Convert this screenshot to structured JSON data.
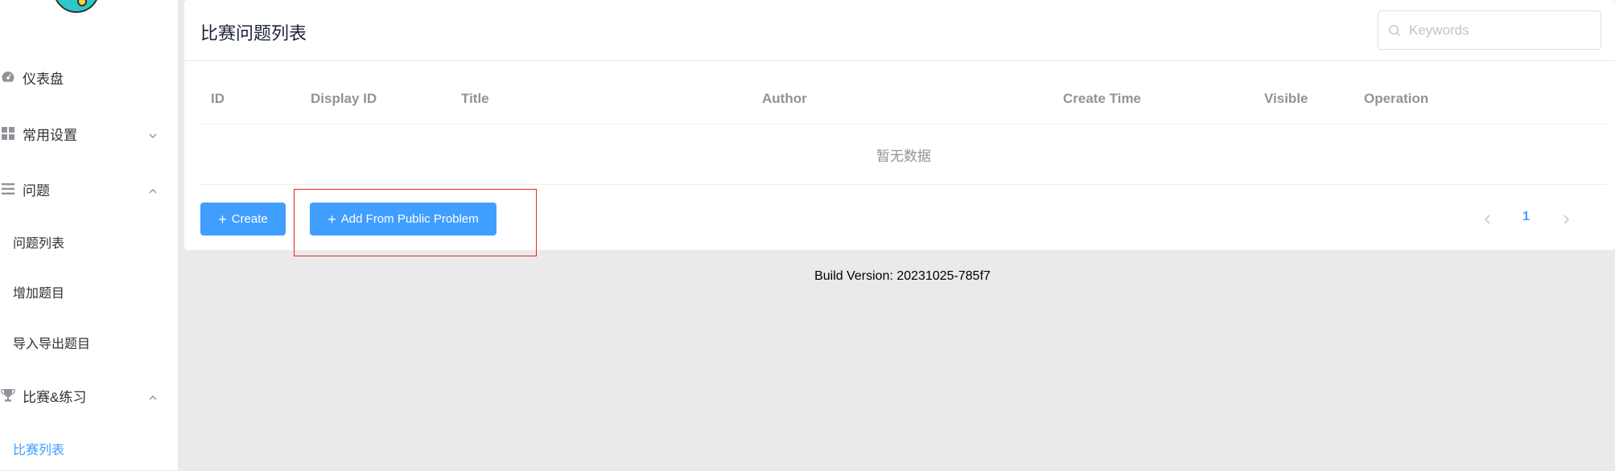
{
  "sidebar": {
    "menu": [
      {
        "label": "仪表盘",
        "icon": "dashboard-icon"
      },
      {
        "label": "常用设置",
        "icon": "grid-icon",
        "arrow": "chevron-down-icon"
      },
      {
        "label": "问题",
        "icon": "list-icon",
        "arrow": "chevron-up-icon"
      },
      {
        "label": "比赛&练习",
        "icon": "trophy-icon",
        "arrow": "chevron-up-icon"
      }
    ],
    "problem_sub": [
      "问题列表",
      "增加题目",
      "导入导出题目"
    ],
    "contest_sub": [
      "比赛列表"
    ]
  },
  "main": {
    "title": "比赛问题列表",
    "search": {
      "placeholder": "Keywords",
      "value": ""
    },
    "table": {
      "columns": [
        "ID",
        "Display ID",
        "Title",
        "Author",
        "Create Time",
        "Visible",
        "Operation"
      ],
      "empty_text": "暂无数据"
    },
    "buttons": {
      "create": "Create",
      "add_public": "Add From Public Problem"
    },
    "pagination": {
      "current": "1"
    }
  },
  "footer": {
    "build": "Build Version: 20231025-785f7"
  },
  "colors": {
    "accent": "#409eff",
    "highlight": "#e0281e",
    "background": "#eaeaea"
  }
}
